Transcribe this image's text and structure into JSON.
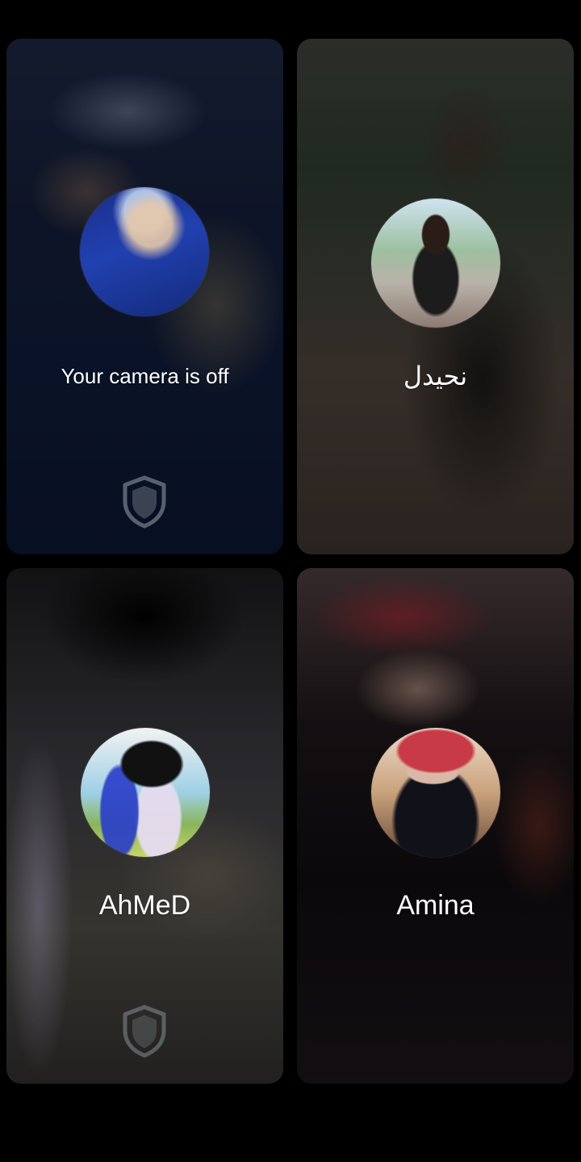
{
  "participants": [
    {
      "label": "Your camera is off",
      "avatar_icon": "person-avatar",
      "shield": true
    },
    {
      "label": "نحيدل",
      "avatar_icon": "person-avatar",
      "shield": false
    },
    {
      "label": "AhMeD",
      "avatar_icon": "person-avatar",
      "shield": true
    },
    {
      "label": "Amina",
      "avatar_icon": "person-avatar",
      "shield": false
    }
  ],
  "colors": {
    "background": "#000000",
    "text": "#ffffff",
    "shield": "#9aa3ad"
  }
}
